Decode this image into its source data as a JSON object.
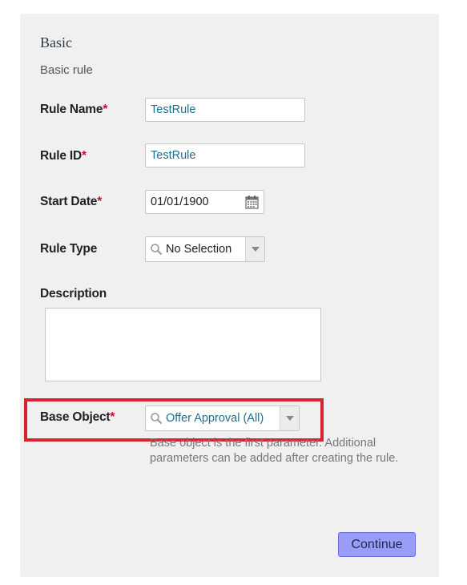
{
  "section": {
    "title": "Basic",
    "subtitle": "Basic rule"
  },
  "required_marker": "*",
  "fields": {
    "rule_name": {
      "label": "Rule Name",
      "required": true,
      "value": "TestRule"
    },
    "rule_id": {
      "label": "Rule ID",
      "required": true,
      "value": "TestRule"
    },
    "start_date": {
      "label": "Start Date",
      "required": true,
      "value": "01/01/1900",
      "icon": "calendar-icon"
    },
    "rule_type": {
      "label": "Rule Type",
      "required": false,
      "value": "No Selection",
      "icon": "search-icon"
    },
    "description": {
      "label": "Description",
      "required": false,
      "value": ""
    },
    "base_object": {
      "label": "Base Object",
      "required": true,
      "value": "Offer Approval (All)",
      "icon": "search-icon",
      "help": "Base object is the first parameter. Additional parameters can be added after creating the rule."
    }
  },
  "actions": {
    "continue_label": "Continue"
  },
  "colors": {
    "panel_bg": "#f0f0f0",
    "required": "#c8102e",
    "highlight": "#d9232e",
    "value_teal": "#1f6f8b",
    "button_bg": "#9b9cf7"
  }
}
